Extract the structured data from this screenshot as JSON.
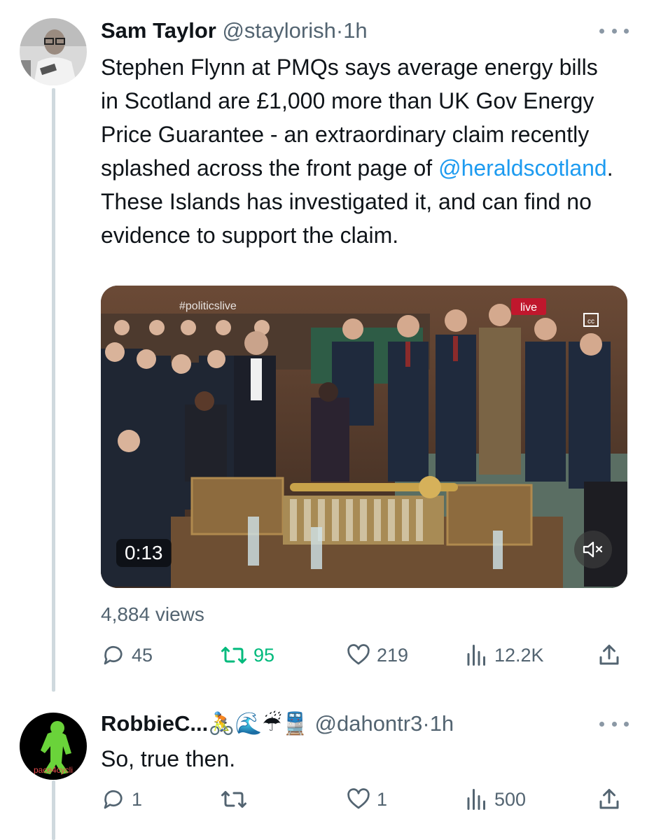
{
  "tweet": {
    "author_name": "Sam Taylor",
    "author_handle": "@staylorish",
    "separator": "·",
    "time": "1h",
    "text_before_mention": "Stephen Flynn at PMQs says average energy bills in Scotland are £1,000 more than UK Gov Energy Price Guarantee - an extraordinary claim recently splashed across the front page of ",
    "mention": "@heraldscotland",
    "text_after_mention": ". These Islands has investigated it, and can find no evidence to support the claim.",
    "video": {
      "watermark": "#politicslive",
      "live_badge": "live",
      "duration": "0:13"
    },
    "views": "4,884 views",
    "actions": {
      "replies": "45",
      "retweets": "95",
      "likes": "219",
      "analytics": "12.2K"
    }
  },
  "reply": {
    "author_name": "RobbieC...🚴🌊☔🚆",
    "author_handle": "@dahontr3",
    "separator": "·",
    "time": "1h",
    "avatar_text": "pace4cycli",
    "text": "So, true then.",
    "actions": {
      "replies": "1",
      "retweets": "",
      "likes": "1",
      "analytics": "500"
    }
  },
  "colors": {
    "accent": "#1d9bf0",
    "retweet_active": "#00ba7c",
    "secondary_text": "#536471",
    "thread_line": "#cfd9de"
  }
}
